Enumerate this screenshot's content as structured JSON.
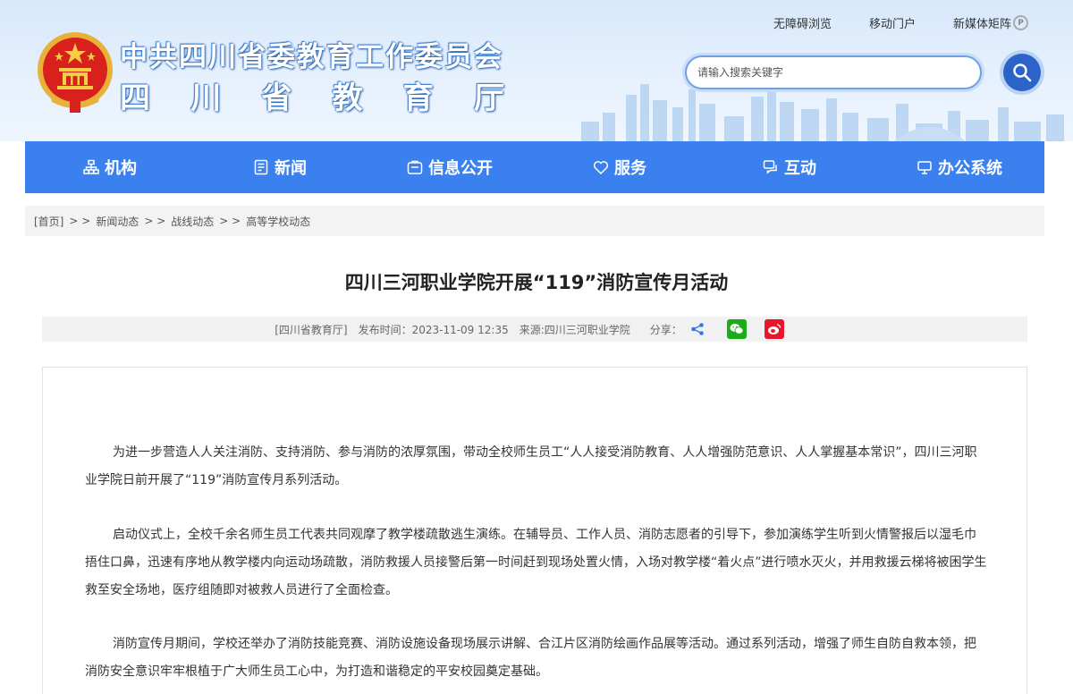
{
  "header": {
    "title_line1": "中共四川省委教育工作委员会",
    "title_line2_chars": [
      "四",
      "川",
      "省",
      "教",
      "育",
      "厅"
    ],
    "top_links": [
      "无障碍浏览",
      "移动门户",
      "新媒体矩阵"
    ],
    "search_placeholder": "请输入搜索关键字"
  },
  "nav": {
    "items": [
      {
        "label": "机构",
        "icon": "org-icon"
      },
      {
        "label": "新闻",
        "icon": "news-icon"
      },
      {
        "label": "信息公开",
        "icon": "info-icon"
      },
      {
        "label": "服务",
        "icon": "service-icon"
      },
      {
        "label": "互动",
        "icon": "interact-icon"
      },
      {
        "label": "办公系统",
        "icon": "office-icon"
      }
    ]
  },
  "breadcrumb": {
    "items": [
      "[首页]",
      "新闻动态",
      "战线动态",
      "高等学校动态"
    ],
    "separator": "> >"
  },
  "article": {
    "title": "四川三河职业学院开展“119”消防宣传月活动",
    "meta": {
      "publisher": "[四川省教育厅]",
      "time": "发布时间：2023-11-09 12:35",
      "source": "来源:四川三河职业学院",
      "share_label": "分享："
    },
    "paragraphs": [
      "为进一步营造人人关注消防、支持消防、参与消防的浓厚氛围，带动全校师生员工“人人接受消防教育、人人增强防范意识、人人掌握基本常识”，四川三河职业学院日前开展了“119”消防宣传月系列活动。",
      "启动仪式上，全校千余名师生员工代表共同观摩了教学楼疏散逃生演练。在辅导员、工作人员、消防志愿者的引导下，参加演练学生听到火情警报后以湿毛巾捂住口鼻，迅速有序地从教学楼内向运动场疏散，消防救援人员接警后第一时间赶到现场处置火情，入场对教学楼“着火点”进行喷水灭火，并用救援云梯将被困学生救至安全场地，医疗组随即对被救人员进行了全面检查。",
      "消防宣传月期间，学校还举办了消防技能竞赛、消防设施设备现场展示讲解、合江片区消防绘画作品展等活动。通过系列活动，增强了师生自防自救本领，把消防安全意识牢牢根植于广大师生员工心中，为打造和谐稳定的平安校园奠定基础。"
    ]
  },
  "colors": {
    "nav_bg": "#3a80ee",
    "search_button": "#2c63c9",
    "wechat_green": "#1aad19",
    "weibo_red": "#e6162d",
    "share_blue": "#2c7ce5"
  }
}
